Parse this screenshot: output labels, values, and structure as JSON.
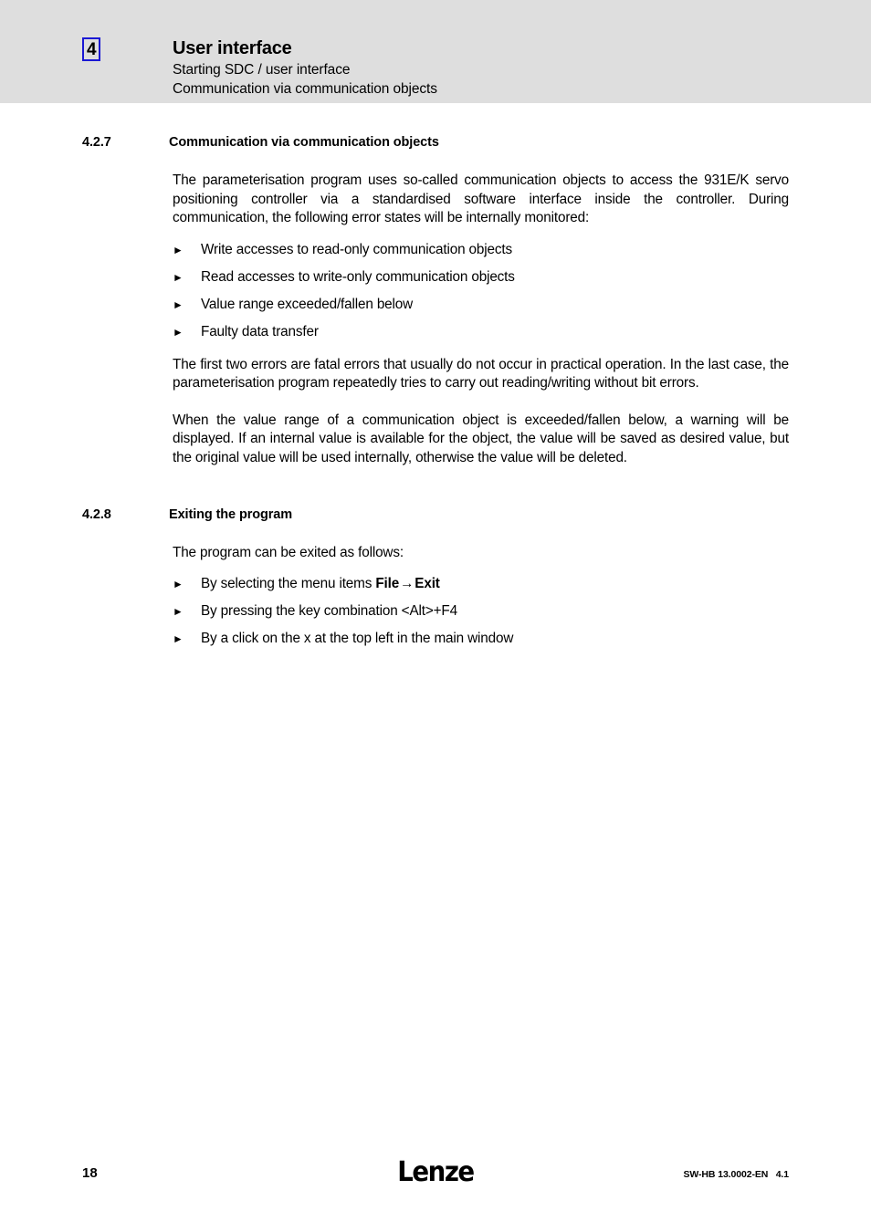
{
  "header": {
    "chapter_number": "4",
    "title": "User interface",
    "subtitle_1": "Starting SDC / user interface",
    "subtitle_2": "Communication via communication objects",
    "band_color": "#dedede",
    "chapter_box_color": "#1a18d4"
  },
  "sections": [
    {
      "number": "4.2.7",
      "title": "Communication via communication objects",
      "paragraph_1": "The parameterisation program uses so-called communication objects to access the 931E/K servo positioning controller via a standardised software interface inside the controller. During communication, the following error states will be internally monitored:",
      "bullets": [
        "Write accesses to read-only communication objects",
        "Read accesses to write-only communication objects",
        "Value range exceeded/fallen below",
        "Faulty data transfer"
      ],
      "paragraph_2": "The first two errors are fatal errors that usually do not occur in practical operation. In the last case, the parameterisation program repeatedly tries to carry out reading/writing without bit errors.",
      "paragraph_3": "When the value range of a communication object is exceeded/fallen below, a warning will be displayed. If an internal value is available for the object, the value will be saved as desired value, but the original value will be used internally, otherwise the value will be deleted."
    },
    {
      "number": "4.2.8",
      "title": "Exiting the program",
      "paragraph_1": "The program can be exited as follows:",
      "bullets": [
        {
          "prefix": "By selecting the menu items ",
          "bold_1": "File",
          "arrow": "→",
          "bold_2": "Exit",
          "suffix": ""
        },
        {
          "text": "By pressing the key combination <Alt>+F4"
        },
        {
          "text": "By a click on the x at the top left in the main window"
        }
      ]
    }
  ],
  "bullet_marker": "►",
  "footer": {
    "page_number": "18",
    "logo_text": "Lenze",
    "doc_code": "SW-HB 13.0002-EN   4.1"
  }
}
